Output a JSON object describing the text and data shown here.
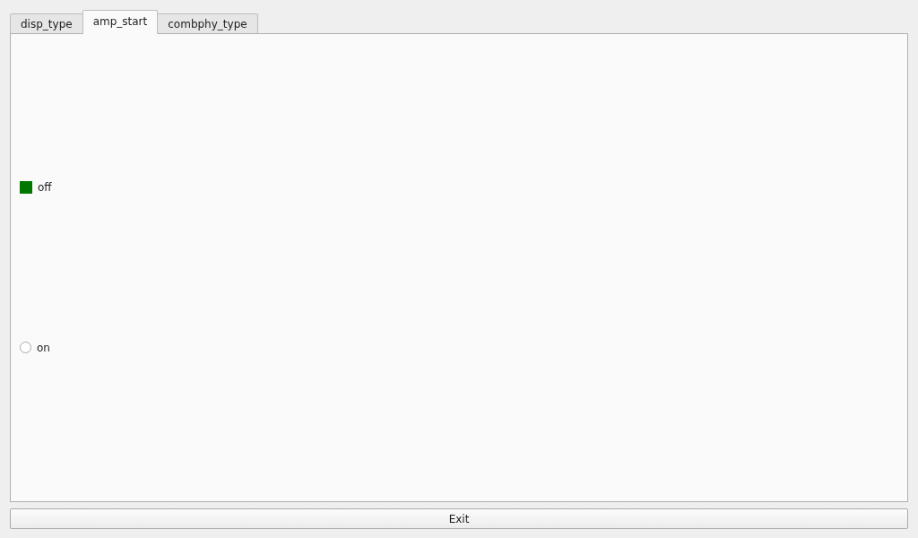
{
  "tabs": [
    {
      "label": "disp_type",
      "selected": false
    },
    {
      "label": "amp_start",
      "selected": true
    },
    {
      "label": "combphy_type",
      "selected": false
    }
  ],
  "options": [
    {
      "label": "off",
      "selected": true
    },
    {
      "label": "on",
      "selected": false
    }
  ],
  "buttons": [
    "Exit"
  ]
}
